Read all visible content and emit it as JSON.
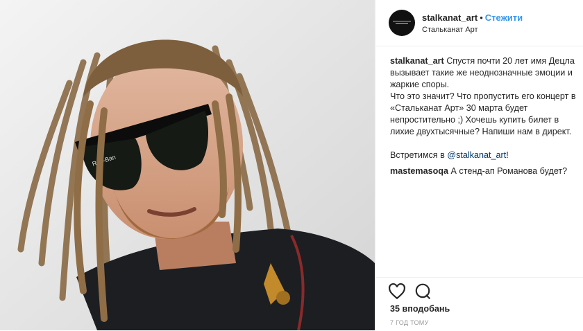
{
  "post": {
    "photo_description": "",
    "photo_overlay_text": "Ray-Ban"
  },
  "header": {
    "username": "stalkanat_art",
    "separator": "•",
    "follow_label": "Стежити",
    "location": "Стальканат Арт",
    "avatar_logo_text": "STALKANAT ART"
  },
  "caption": {
    "username": "stalkanat_art",
    "line1": "Спустя почти 20 лет имя Децла вызывает такие же неоднозначные эмоции и жаркие споры.",
    "line2": "Что это значит? Что пропустить его концерт в «Стальканат Арт» 30 марта будет непростительно ;) Хочешь купить билет в лихие двухтысячные? Напиши нам в директ.",
    "line3_prefix": "Встретимся в ",
    "line3_mention": "@stalkanat_art",
    "line3_suffix": "!"
  },
  "comments": [
    {
      "username": "mastemasoqa",
      "text": "А стенд-ап Романова будет?"
    }
  ],
  "actions": {
    "like_icon": "heart-outline-icon",
    "comment_icon": "speech-bubble-icon",
    "likes_text": "35 вподобань",
    "time_text": "7 ГОД ТОМУ"
  },
  "colors": {
    "link_blue": "#3897f0",
    "text": "#262626",
    "muted": "#999999",
    "border": "#efefef"
  }
}
